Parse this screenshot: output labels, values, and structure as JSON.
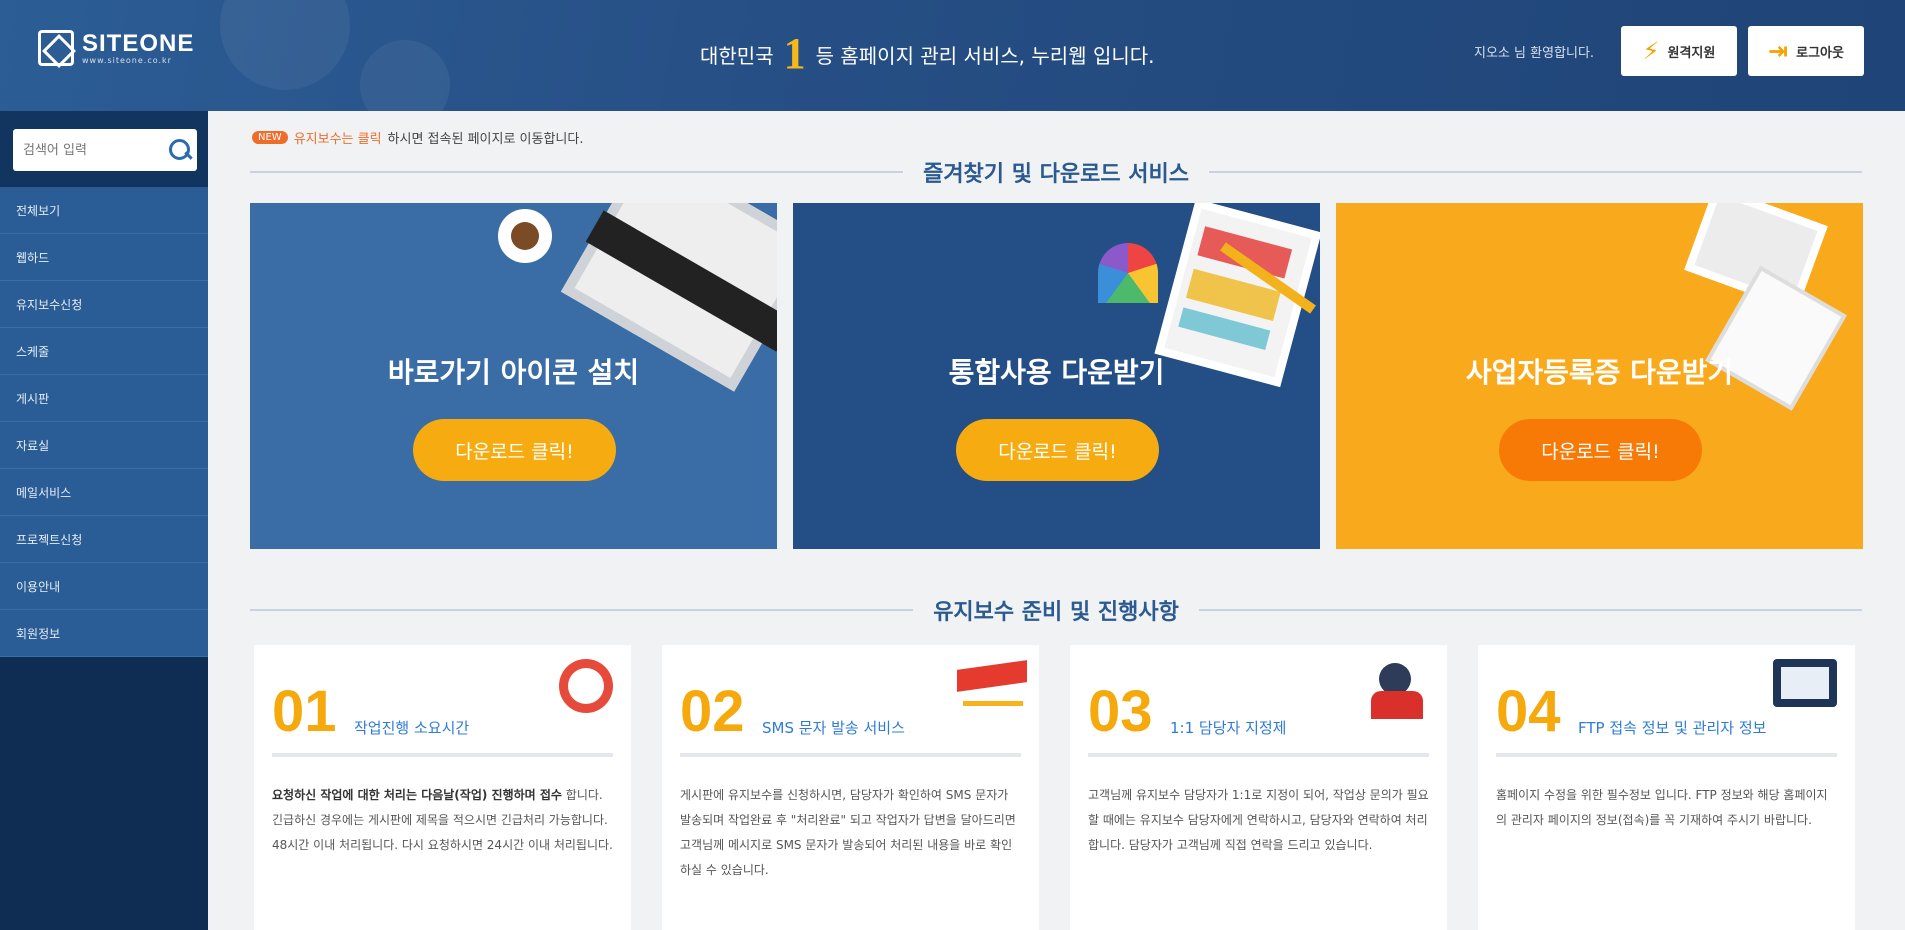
{
  "header": {
    "logo_title": "SITEONE",
    "logo_sub": "www.siteone.co.kr",
    "slogan_before": "대한민국",
    "slogan_num": "1",
    "slogan_after": "등 홈페이지 관리 서비스, 누리웹 입니다.",
    "welcome": "지오소 님 환영합니다.",
    "btn1_label": "원격지원",
    "btn2_label": "로그아웃"
  },
  "sidebar": {
    "search_placeholder": "검색어 입력",
    "items": [
      {
        "label": "전체보기"
      },
      {
        "label": "웹하드"
      },
      {
        "label": "유지보수신청"
      },
      {
        "label": "스케줄"
      },
      {
        "label": "게시판"
      },
      {
        "label": "자료실"
      },
      {
        "label": "메일서비스"
      },
      {
        "label": "프로젝트신청"
      },
      {
        "label": "이용안내"
      },
      {
        "label": "회원정보"
      }
    ]
  },
  "notice": {
    "badge": "NEW",
    "highlight": "유지보수는 클릭",
    "text": "하시면 접속된 페이지로 이동합니다."
  },
  "section1_title": "즐겨찾기 및 다운로드 서비스",
  "banners": [
    {
      "title": "바로가기 아이콘 설치",
      "button": "다운로드 클릭!"
    },
    {
      "title": "통합사용 다운받기",
      "button": "다운로드 클릭!"
    },
    {
      "title": "사업자등록증 다운받기",
      "button": "다운로드 클릭!"
    }
  ],
  "section2_title": "유지보수 준비 및 진행사항",
  "cards": [
    {
      "num": "01",
      "title": "작업진행 소요시간",
      "body_bold": "요청하신 작업에 대한 처리는 다음날(작업) 진행하며 접수",
      "body": "합니다. 긴급하신 경우에는 게시판에 제목을 적으시면 긴급처리 가능합니다. 48시간 이내 처리됩니다. 다시 요청하시면 24시간 이내 처리됩니다."
    },
    {
      "num": "02",
      "title": "SMS 문자 발송 서비스",
      "body_bold": "",
      "body": "게시판에 유지보수를 신청하시면, 담당자가 확인하여 SMS 문자가 발송되며 작업완료 후 \"처리완료\" 되고 작업자가 답변을 달아드리면 고객님께 메시지로 SMS 문자가 발송되어 처리된 내용을 바로 확인하실 수 있습니다."
    },
    {
      "num": "03",
      "title": "1:1 담당자 지정제",
      "body_bold": "",
      "body": "고객님께 유지보수 담당자가 1:1로 지정이 되어, 작업상 문의가 필요할 때에는 유지보수 담당자에게 연락하시고, 담당자와 연락하여 처리합니다. 담당자가 고객님께 직접 연락을 드리고 있습니다."
    },
    {
      "num": "04",
      "title": "FTP 접속 정보 및 관리자 정보",
      "body_bold": "",
      "body": "홈페이지 수정을 위한 필수정보 입니다. FTP 정보와 해당 홈페이지의 관리자 페이지의 정보(접속)를 꼭 기재하여 주시기 바랍니다."
    }
  ]
}
